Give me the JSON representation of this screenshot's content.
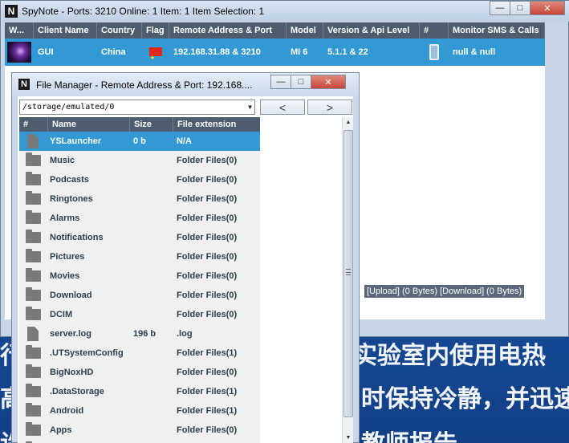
{
  "main_window": {
    "logo": "N",
    "title": "SpyNote - Ports: 3210 Online: 1 Item: 1 Item Selection: 1",
    "controls": {
      "minimize": "—",
      "maximize": "□",
      "close": "✕"
    }
  },
  "client_table": {
    "columns": [
      "W...",
      "Client Name",
      "Country",
      "Flag",
      "Remote Address & Port",
      "Model",
      "Version & Api Level",
      "#",
      "Monitor SMS & Calls"
    ],
    "row": {
      "client_name": "GUI",
      "country": "China",
      "remote": "192.168.31.88 & 3210",
      "model": "MI 6",
      "version": "5.1.1 & 22",
      "monitor": "null & null"
    }
  },
  "status_strip": "[Upload] (0 Bytes) [Download] (0 Bytes)",
  "file_manager": {
    "logo": "N",
    "title": "File Manager - Remote Address & Port: 192.168....",
    "controls": {
      "minimize": "—",
      "maximize": "□",
      "close": "✕"
    },
    "path": "/storage/emulated/0",
    "nav": {
      "back": "<",
      "forward": ">"
    },
    "columns": [
      "#",
      "Name",
      "Size",
      "File extension"
    ],
    "files": [
      {
        "type": "file",
        "name": "YSLauncher",
        "size": "0 b",
        "ext": "N/A",
        "selected": true
      },
      {
        "type": "folder",
        "name": "Music",
        "size": "",
        "ext": "Folder Files(0)"
      },
      {
        "type": "folder",
        "name": "Podcasts",
        "size": "",
        "ext": "Folder Files(0)"
      },
      {
        "type": "folder",
        "name": "Ringtones",
        "size": "",
        "ext": "Folder Files(0)"
      },
      {
        "type": "folder",
        "name": "Alarms",
        "size": "",
        "ext": "Folder Files(0)"
      },
      {
        "type": "folder",
        "name": "Notifications",
        "size": "",
        "ext": "Folder Files(0)"
      },
      {
        "type": "folder",
        "name": "Pictures",
        "size": "",
        "ext": "Folder Files(0)"
      },
      {
        "type": "folder",
        "name": "Movies",
        "size": "",
        "ext": "Folder Files(0)"
      },
      {
        "type": "folder",
        "name": "Download",
        "size": "",
        "ext": "Folder Files(0)"
      },
      {
        "type": "folder",
        "name": "DCIM",
        "size": "",
        "ext": "Folder Files(0)"
      },
      {
        "type": "file",
        "name": "server.log",
        "size": "196 b",
        "ext": ".log"
      },
      {
        "type": "folder",
        "name": ".UTSystemConfig",
        "size": "",
        "ext": "Folder Files(1)"
      },
      {
        "type": "folder",
        "name": "BigNoxHD",
        "size": "",
        "ext": "Folder Files(0)"
      },
      {
        "type": "folder",
        "name": ".DataStorage",
        "size": "",
        "ext": "Folder Files(1)"
      },
      {
        "type": "folder",
        "name": "Android",
        "size": "",
        "ext": "Folder Files(1)"
      },
      {
        "type": "folder",
        "name": "Apps",
        "size": "",
        "ext": "Folder Files(0)"
      },
      {
        "type": "folder",
        "name": "",
        "size": "",
        "ext": ""
      }
    ]
  },
  "background_text": {
    "right_1": "实验室内使用电热",
    "right_2": "时保持冷静，并迅速",
    "right_3": "教师报告",
    "left_1": "行",
    "left_2": "高",
    "left_3": "许"
  }
}
